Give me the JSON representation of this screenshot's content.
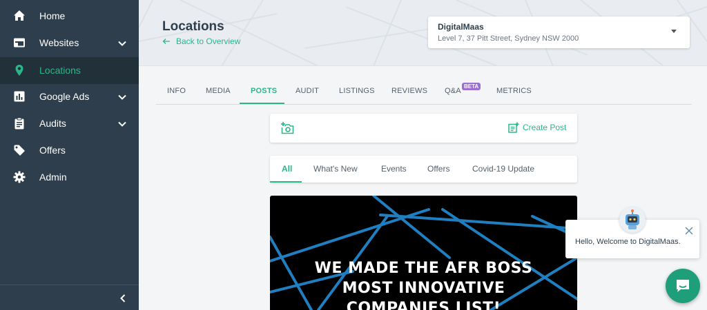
{
  "sidebar": {
    "items": [
      {
        "label": "Home",
        "icon": "home-icon"
      },
      {
        "label": "Websites",
        "icon": "browser-icon"
      },
      {
        "label": "Locations",
        "icon": "map-pin-icon"
      },
      {
        "label": "Google Ads",
        "icon": "bar-chart-icon"
      },
      {
        "label": "Audits",
        "icon": "clipboard-icon"
      },
      {
        "label": "Offers",
        "icon": "tag-icon"
      },
      {
        "label": "Admin",
        "icon": "gear-icon"
      }
    ]
  },
  "header": {
    "title": "Locations",
    "back_label": "Back to Overview"
  },
  "location": {
    "name": "DigitalMaas",
    "address": "Level 7, 37 Pitt Street, Sydney NSW 2000"
  },
  "tabs": [
    "INFO",
    "MEDIA",
    "POSTS",
    "AUDIT",
    "LISTINGS",
    "REVIEWS",
    "Q&A",
    "METRICS"
  ],
  "beta_badge": "BETA",
  "create_post_label": "Create Post",
  "filters": [
    "All",
    "What's New",
    "Events",
    "Offers",
    "Covid-19 Update"
  ],
  "post": {
    "headline_lines": [
      "WE MADE THE AFR BOSS",
      "MOST INNOVATIVE",
      "COMPANIES LIST!"
    ]
  },
  "chat": {
    "message": "Hello, Welcome to DigitalMaas."
  },
  "colors": {
    "accent": "#2bb68a",
    "sidebar": "#2e3e4c",
    "sidebar_active": "#213039",
    "beta": "#9b6fd1",
    "chat_launcher": "#1e9e79",
    "post_lines": "#1f7fc1"
  }
}
